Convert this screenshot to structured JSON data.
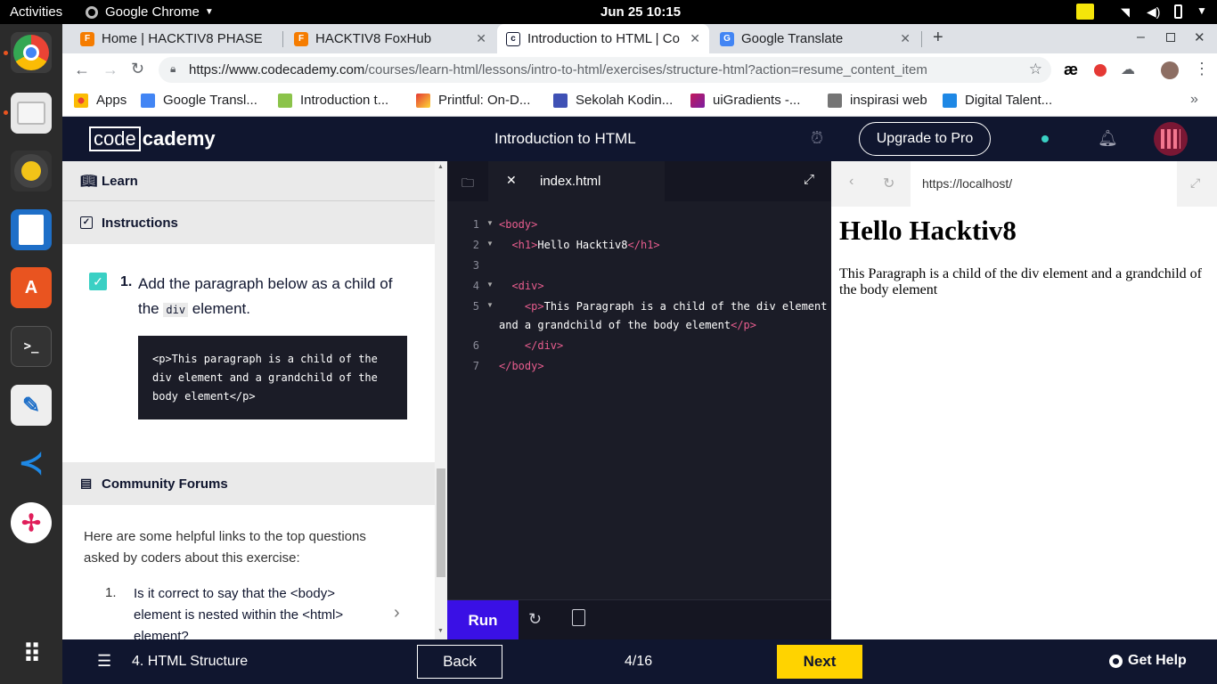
{
  "os": {
    "activities": "Activities",
    "app_name": "Google Chrome",
    "datetime": "Jun 25  10:15"
  },
  "chrome": {
    "tabs": [
      {
        "label": "Home | HACKTIV8 PHASE",
        "active": false
      },
      {
        "label": "HACKTIV8 FoxHub",
        "active": false
      },
      {
        "label": "Introduction to HTML | Co",
        "active": true
      },
      {
        "label": "Google Translate",
        "active": false
      }
    ],
    "url_host": "https://www.codecademy.com",
    "url_path": "/courses/learn-html/lessons/intro-to-html/exercises/structure-html?action=resume_content_item",
    "bookmarks": [
      {
        "label": "Apps",
        "color": "#ea4335"
      },
      {
        "label": "Google Transl...",
        "color": "#4285f4"
      },
      {
        "label": "Introduction t...",
        "color": "#8bc34a"
      },
      {
        "label": "Printful: On-D...",
        "color": "#e53935"
      },
      {
        "label": "Sekolah Kodin...",
        "color": "#3f51b5"
      },
      {
        "label": "uiGradients -...",
        "color": "#c2185b"
      },
      {
        "label": "inspirasi web",
        "color": "#757575"
      },
      {
        "label": "Digital Talent...",
        "color": "#1e88e5"
      }
    ]
  },
  "header": {
    "logo_left": "code",
    "logo_right": "cademy",
    "title": "Introduction to HTML",
    "upgrade_label": "Upgrade to Pro"
  },
  "left": {
    "learn_label": "Learn",
    "instructions_label": "Instructions",
    "task_number": "1.",
    "task_text_before": "Add the paragraph below as a child of the",
    "task_code": "div",
    "task_text_after": "element.",
    "snippet_lines": [
      "<p>This paragraph is a child of the",
      "div element and a grandchild of the",
      "body element</p>"
    ],
    "community_label": "Community Forums",
    "community_intro": "Here are some helpful links to the top questions asked by coders about this exercise:",
    "question_number": "1.",
    "question_text": "Is it correct to say that the <body> element is nested within the <html> element?"
  },
  "editor": {
    "filename": "index.html",
    "line_numbers": [
      "1",
      "2",
      "3",
      "4",
      "5",
      "6",
      "7"
    ],
    "lines": [
      {
        "indent": "",
        "open": "<body>",
        "text": "",
        "close": ""
      },
      {
        "indent": "  ",
        "open": "<h1>",
        "text": "Hello Hacktiv8",
        "close": "</h1>"
      },
      {
        "indent": "",
        "open": "",
        "text": "",
        "close": ""
      },
      {
        "indent": "  ",
        "open": "<div>",
        "text": "",
        "close": ""
      },
      {
        "indent": "    ",
        "open": "<p>",
        "text": "This Paragraph is a child of the div element",
        "close": ""
      },
      {
        "indent": "",
        "open": "",
        "text": "and a grandchild of the body element",
        "close": "</p>"
      },
      {
        "indent": "    ",
        "open": "",
        "text": "",
        "close": "</div>"
      },
      {
        "indent": "",
        "open": "",
        "text": "",
        "close": "</body>"
      }
    ],
    "run_label": "Run"
  },
  "preview": {
    "address": "https://localhost/",
    "heading": "Hello Hacktiv8",
    "paragraph": "This Paragraph is a child of the div element and a grandchild of the body element"
  },
  "footer": {
    "lesson_label": "4. HTML Structure",
    "back_label": "Back",
    "progress": "4/16",
    "next_label": "Next",
    "help_label": "Get Help"
  },
  "colors": {
    "accent": "#3a10e5",
    "next": "#ffd300",
    "header": "#10162f"
  }
}
